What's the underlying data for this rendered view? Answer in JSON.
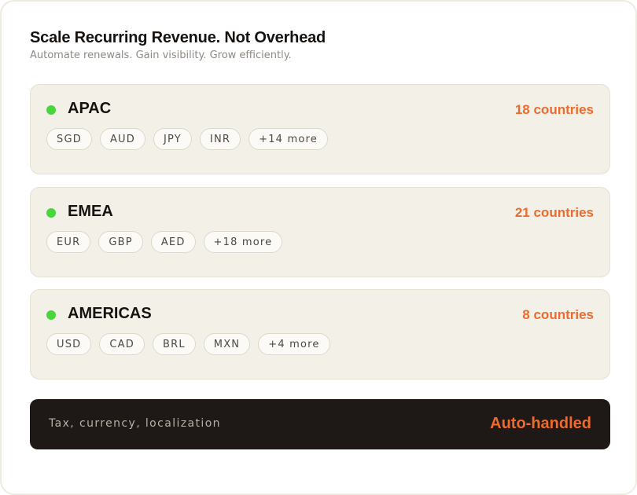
{
  "header": {
    "title": "Scale Recurring Revenue. Not Overhead",
    "subtitle": "Automate renewals. Gain visibility. Grow efficiently."
  },
  "regions": [
    {
      "name": "APAC",
      "count": "18 countries",
      "chips": [
        "SGD",
        "AUD",
        "JPY",
        "INR",
        "+14 more"
      ]
    },
    {
      "name": "EMEA",
      "count": "21 countries",
      "chips": [
        "EUR",
        "GBP",
        "AED",
        "+18 more"
      ]
    },
    {
      "name": "AMERICAS",
      "count": "8 countries",
      "chips": [
        "USD",
        "CAD",
        "BRL",
        "MXN",
        "+4 more"
      ]
    }
  ],
  "footer": {
    "label": "Tax, currency, localization",
    "status": "Auto-handled"
  },
  "colors": {
    "accent": "#ec6b2d",
    "status_dot": "#49d63c",
    "panel": "#f3f0e7",
    "footer_bg": "#1e1917"
  }
}
